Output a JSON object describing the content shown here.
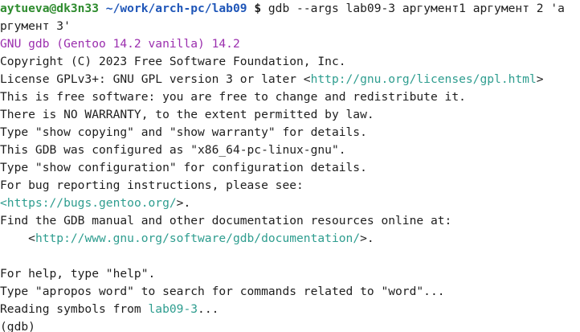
{
  "colors": {
    "background": "#ffffff",
    "text": "#1e1e1e",
    "prompt_user": "#2e8b2e",
    "prompt_path": "#1f56b8",
    "banner": "#9b2fae",
    "link": "#2e9d8f"
  },
  "prompt": {
    "user_host": "aytueva@dk3n33",
    "path": " ~/work/arch-pc/lab09",
    "sign": " $",
    "command": " gdb --args lab09-3 аргумент1 аргумент 2 'a",
    "command_wrap": "ргумент 3'"
  },
  "output": {
    "banner": "GNU gdb (Gentoo 14.2 vanilla) 14.2",
    "copyright": "Copyright (C) 2023 Free Software Foundation, Inc.",
    "license_prefix": "License GPLv3+: GNU GPL version 3 or later <",
    "license_url": "http://gnu.org/licenses/gpl.html",
    "license_suffix": ">",
    "free_software": "This is free software: you are free to change and redistribute it.",
    "no_warranty": "There is NO WARRANTY, to the extent permitted by law.",
    "show_copying": "Type \"show copying\" and \"show warranty\" for details.",
    "configured": "This GDB was configured as \"x86_64-pc-linux-gnu\".",
    "show_config": "Type \"show configuration\" for configuration details.",
    "bug_reporting": "For bug reporting instructions, please see:",
    "bug_url_prefix": "<",
    "bug_url": "https://bugs.gentoo.org/",
    "bug_url_suffix": ">.",
    "find_manual": "Find the GDB manual and other documentation resources online at:",
    "doc_prefix": "    <",
    "doc_url": "http://www.gnu.org/software/gdb/documentation/",
    "doc_suffix": ">.",
    "blank": "",
    "help": "For help, type \"help\".",
    "apropos": "Type \"apropos word\" to search for commands related to \"word\"...",
    "reading_prefix": "Reading symbols from ",
    "reading_file": "lab09-3",
    "reading_suffix": "...",
    "gdb_prompt": "(gdb)"
  }
}
